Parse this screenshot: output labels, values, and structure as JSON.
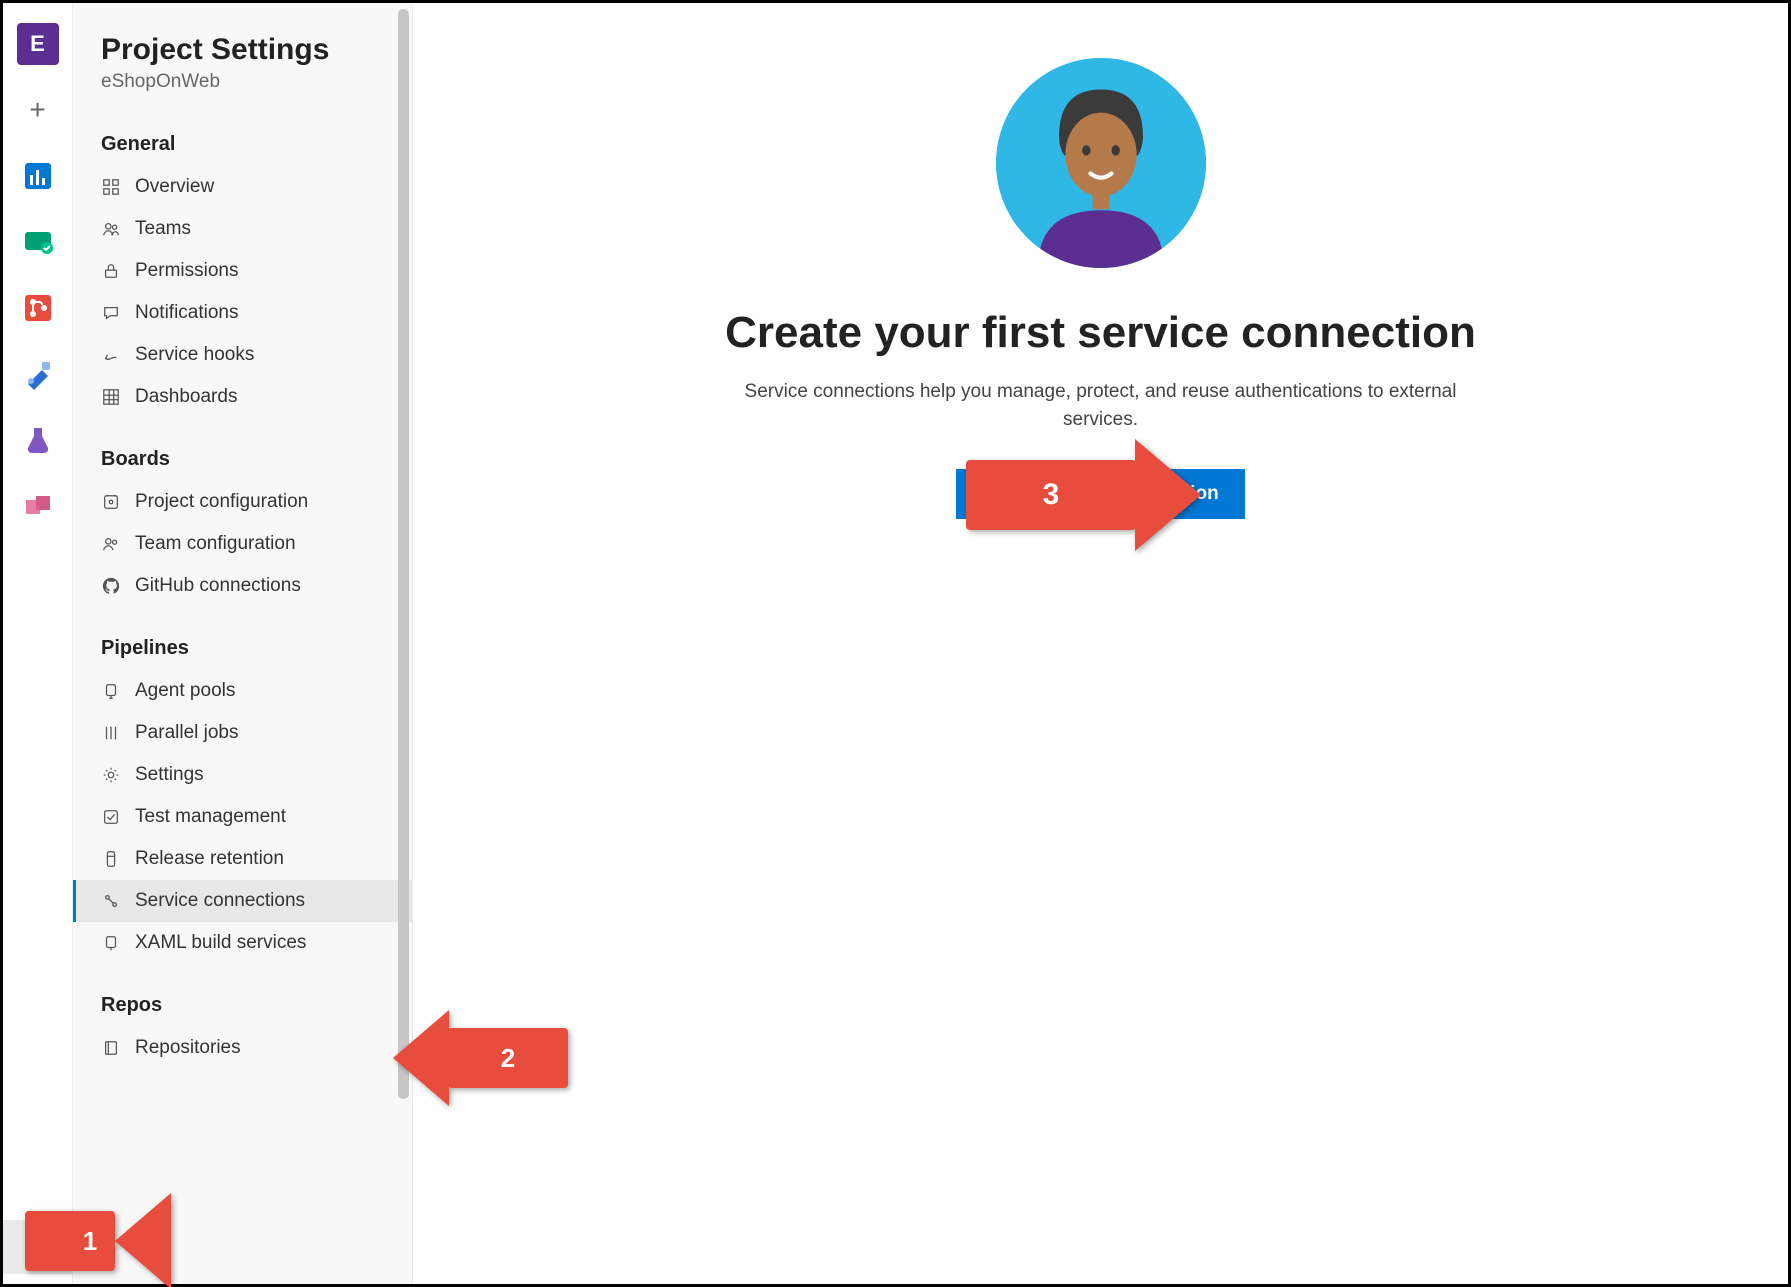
{
  "rail": {
    "project_letter": "E",
    "add_label": "+"
  },
  "sidebar": {
    "title": "Project Settings",
    "subtitle": "eShopOnWeb",
    "sections": {
      "general": {
        "heading": "General",
        "items": [
          "Overview",
          "Teams",
          "Permissions",
          "Notifications",
          "Service hooks",
          "Dashboards"
        ]
      },
      "boards": {
        "heading": "Boards",
        "items": [
          "Project configuration",
          "Team configuration",
          "GitHub connections"
        ]
      },
      "pipelines": {
        "heading": "Pipelines",
        "items": [
          "Agent pools",
          "Parallel jobs",
          "Settings",
          "Test management",
          "Release retention",
          "Service connections",
          "XAML build services"
        ]
      },
      "repos": {
        "heading": "Repos",
        "items": [
          "Repositories"
        ]
      }
    },
    "selected_item": "Service connections"
  },
  "main": {
    "heading": "Create your first service connection",
    "sub": "Service connections help you manage, protect, and reuse authentications to external services.",
    "button_label": "Create service connection"
  },
  "callouts": {
    "one": "1",
    "two": "2",
    "three": "3"
  }
}
